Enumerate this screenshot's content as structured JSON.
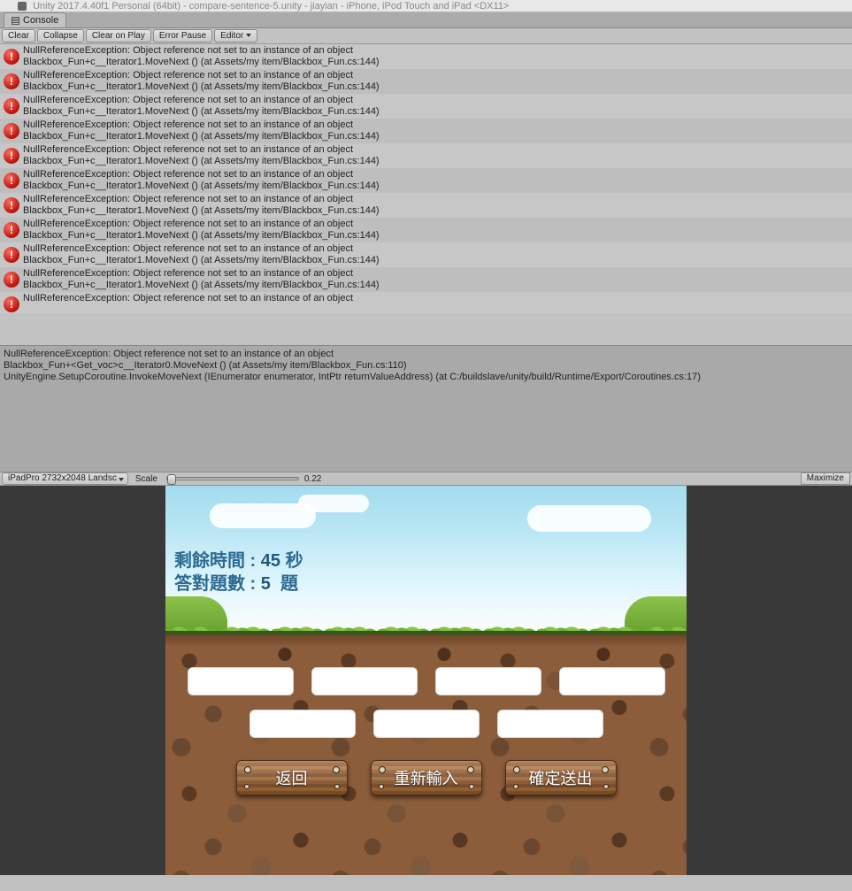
{
  "titlebar": "Unity 2017.4.40f1 Personal (64bit) - compare-sentence-5.unity - jiayian - iPhone, iPod Touch and iPad <DX11>",
  "console": {
    "tab_label": "Console",
    "toolbar": {
      "clear": "Clear",
      "collapse": "Collapse",
      "clear_on_play": "Clear on Play",
      "error_pause": "Error Pause",
      "editor": "Editor"
    },
    "log": {
      "line1": "NullReferenceException: Object reference not set to an instance of an object",
      "line2": "Blackbox_Fun+<Get_sen>c__Iterator1.MoveNext () (at Assets/my item/Blackbox_Fun.cs:144)",
      "tail": "NullReferenceException: Object reference not set to an instance of an object"
    },
    "detail": "NullReferenceException: Object reference not set to an instance of an object\nBlackbox_Fun+<Get_voc>c__Iterator0.MoveNext () (at Assets/my item/Blackbox_Fun.cs:110)\nUnityEngine.SetupCoroutine.InvokeMoveNext (IEnumerator enumerator, IntPtr returnValueAddress) (at C:/buildslave/unity/build/Runtime/Export/Coroutines.cs:17)"
  },
  "game_toolbar": {
    "aspect": "iPadPro 2732x2048 Landsc",
    "scale_label": "Scale",
    "scale_value": "0.22",
    "maximize": "Maximize"
  },
  "game": {
    "time_label": "剩餘時間 :",
    "time_value": "45",
    "time_unit": "秒",
    "score_label": "答對題數 :",
    "score_value": "5",
    "score_unit": "題",
    "btn_back": "返回",
    "btn_reset": "重新輸入",
    "btn_submit": "確定送出"
  }
}
